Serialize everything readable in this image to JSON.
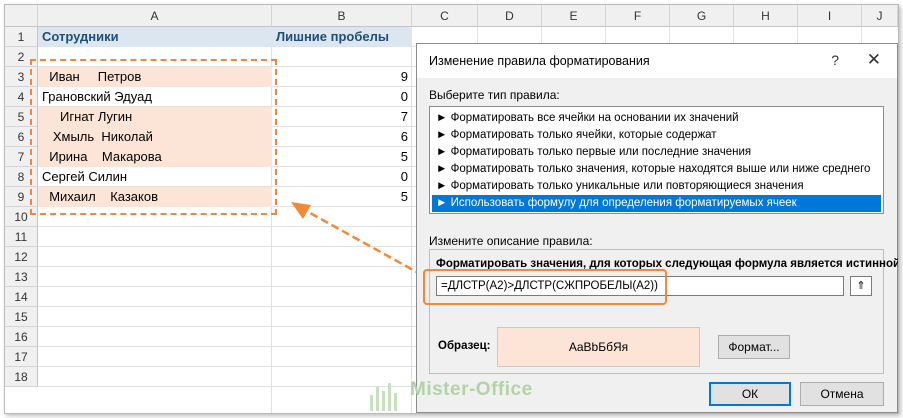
{
  "columns": [
    "A",
    "B",
    "C",
    "D",
    "E",
    "F",
    "G",
    "H",
    "I",
    "J"
  ],
  "rows": [
    "1",
    "2",
    "3",
    "4",
    "5",
    "6",
    "7",
    "8",
    "9",
    "10",
    "11",
    "12",
    "13",
    "14",
    "15",
    "16",
    "17",
    "18"
  ],
  "sheet": {
    "header_a": "Сотрудники",
    "header_b": "Лишние пробелы",
    "data": [
      {
        "name": "  Иван     Петров",
        "spaces": "9",
        "highlight": true
      },
      {
        "name": "Грановский Эдуад",
        "spaces": "0",
        "highlight": false
      },
      {
        "name": "     Игнат Лугин",
        "spaces": "7",
        "highlight": true
      },
      {
        "name": "   Хмыль  Николай",
        "spaces": "6",
        "highlight": true
      },
      {
        "name": "  Ирина    Макарова",
        "spaces": "5",
        "highlight": true
      },
      {
        "name": "Сергей Силин",
        "spaces": "0",
        "highlight": false
      },
      {
        "name": "  Михаил    Казаков",
        "spaces": "5",
        "highlight": true
      }
    ]
  },
  "dialog": {
    "title": "Изменение правила форматирования",
    "help": "?",
    "close": "✕",
    "select_type_label": "Выберите тип правила:",
    "rule_types": [
      "► Форматировать все ячейки на основании их значений",
      "► Форматировать только ячейки, которые содержат",
      "► Форматировать только первые или последние значения",
      "► Форматировать только значения, которые находятся выше или ниже среднего",
      "► Форматировать только уникальные или повторяющиеся значения",
      "► Использовать формулу для определения форматируемых ячеек"
    ],
    "selected_index": 5,
    "edit_desc_label": "Измените описание правила:",
    "formula_label": "Форматировать значения, для которых следующая формула является истинной:",
    "formula_value": "=ДЛСТР(A2)>ДЛСТР(СЖПРОБЕЛЫ(A2))",
    "collapse_icon": "⇑",
    "sample_label": "Образец:",
    "sample_text": "AaBbБбЯя",
    "format_button": "Формат...",
    "ok_button": "ОК",
    "cancel_button": "Отмена"
  },
  "watermark": "Mister-Office",
  "colors": {
    "highlight": "#fce4d6",
    "accent": "#f08a38",
    "selection": "#0078d7"
  }
}
